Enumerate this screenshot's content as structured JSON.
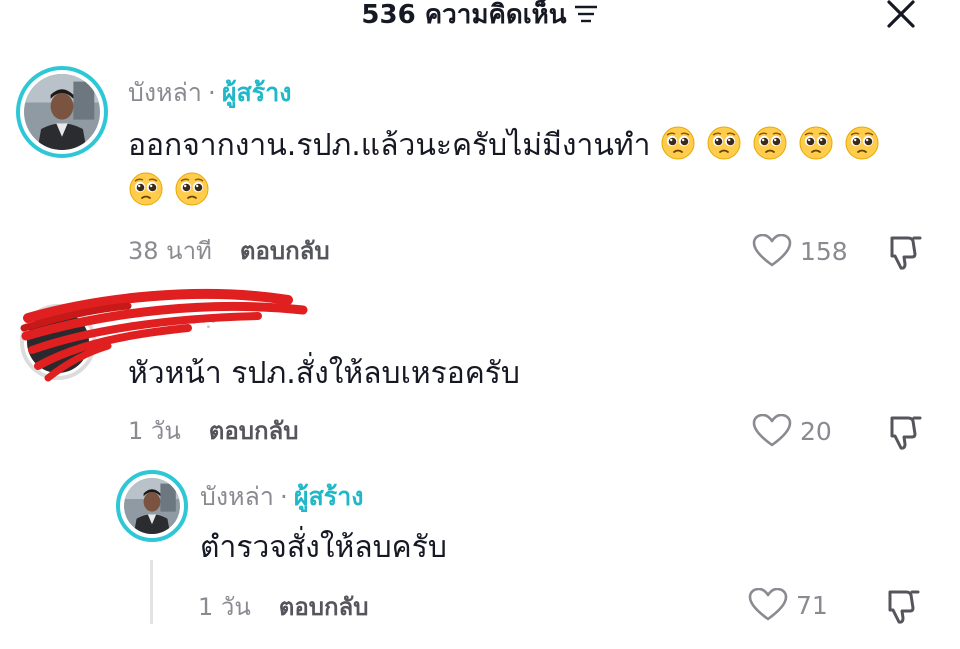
{
  "header": {
    "title": "536 ความคิดเห็น",
    "filter_icon": "filter-lines-icon",
    "close_icon": "close-icon"
  },
  "comments": [
    {
      "username": "บังหล่า",
      "separator": "·",
      "creator_badge": "ผู้สร้าง",
      "text_line1": "ออกจากงาน.รปภ.แล้วนะครับไม่มีงานทำ",
      "text_line2": "",
      "emoji": "pleading-face-icon",
      "emoji_count": 7,
      "time": "38 นาที",
      "reply_label": "ตอบกลับ",
      "likes": "158"
    },
    {
      "username_redacted": "·⁘",
      "text_line1": "หัวหน้า รปภ.สั่งให้ลบเหรอครับ",
      "time": "1 วัน",
      "reply_label": "ตอบกลับ",
      "likes": "20"
    },
    {
      "username": "บังหล่า",
      "separator": "·",
      "creator_badge": "ผู้สร้าง",
      "text_line1": "ตำรวจสั่งให้ลบครับ",
      "time": "1 วัน",
      "reply_label": "ตอบกลับ",
      "likes": "71"
    }
  ],
  "colors": {
    "creator_accent": "#20b8c9",
    "avatar_ring": "#2ec7d6",
    "muted_text": "#8a8b91",
    "redaction": "#e02020"
  }
}
